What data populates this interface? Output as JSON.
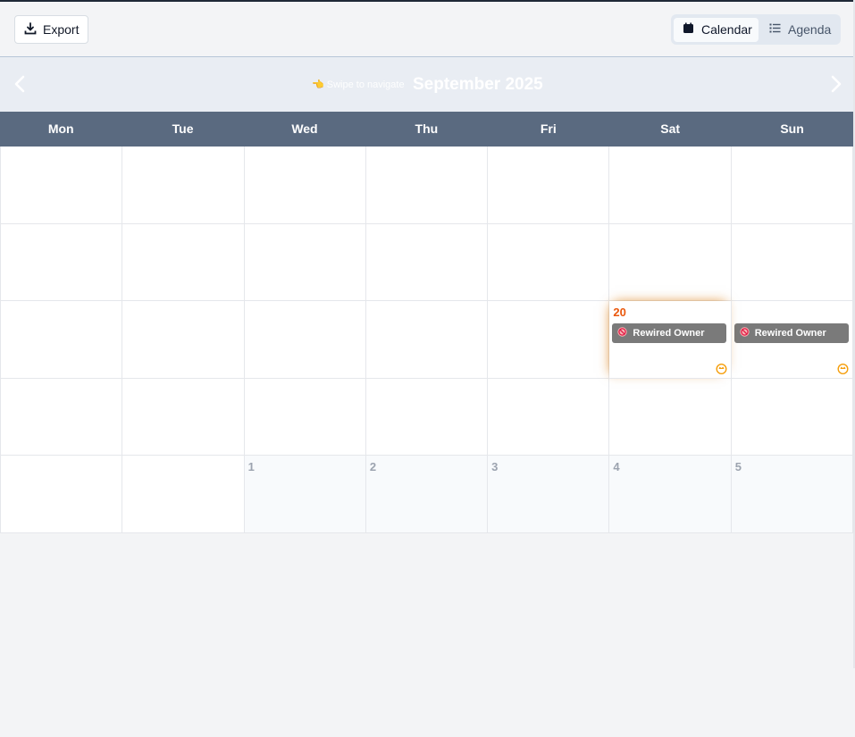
{
  "toolbar": {
    "export_label": "Export",
    "export_icon": "download-icon",
    "views": [
      {
        "label": "Calendar",
        "icon": "calendar-icon",
        "active": true
      },
      {
        "label": "Agenda",
        "icon": "list-icon",
        "active": false
      }
    ]
  },
  "nav": {
    "swipe_hint": "👈 Swipe to navigate",
    "month_title": "September 2025",
    "prev_icon": "chevron-left-icon",
    "next_icon": "chevron-right-icon"
  },
  "weekdays": [
    "Mon",
    "Tue",
    "Wed",
    "Thu",
    "Fri",
    "Sat",
    "Sun"
  ],
  "colors": {
    "header_bg": "#5a6a80",
    "today_accent": "#ea580c",
    "event_bg": "#7a7a7a",
    "crown": "#f59e0b"
  },
  "weeks": [
    [
      {
        "day": ""
      },
      {
        "day": ""
      },
      {
        "day": ""
      },
      {
        "day": ""
      },
      {
        "day": ""
      },
      {
        "day": ""
      },
      {
        "day": ""
      }
    ],
    [
      {
        "day": ""
      },
      {
        "day": ""
      },
      {
        "day": ""
      },
      {
        "day": ""
      },
      {
        "day": ""
      },
      {
        "day": ""
      },
      {
        "day": ""
      }
    ],
    [
      {
        "day": ""
      },
      {
        "day": ""
      },
      {
        "day": ""
      },
      {
        "day": ""
      },
      {
        "day": ""
      },
      {
        "day": "20",
        "today": true,
        "event": "Rewired Owner",
        "crown": true
      },
      {
        "day": "",
        "event": "Rewired Owner",
        "crown": true
      }
    ],
    [
      {
        "day": ""
      },
      {
        "day": ""
      },
      {
        "day": ""
      },
      {
        "day": ""
      },
      {
        "day": ""
      },
      {
        "day": ""
      },
      {
        "day": ""
      }
    ],
    [
      {
        "day": ""
      },
      {
        "day": ""
      },
      {
        "day": "1",
        "other": true
      },
      {
        "day": "2",
        "other": true
      },
      {
        "day": "3",
        "other": true
      },
      {
        "day": "4",
        "other": true
      },
      {
        "day": "5",
        "other": true
      }
    ]
  ]
}
